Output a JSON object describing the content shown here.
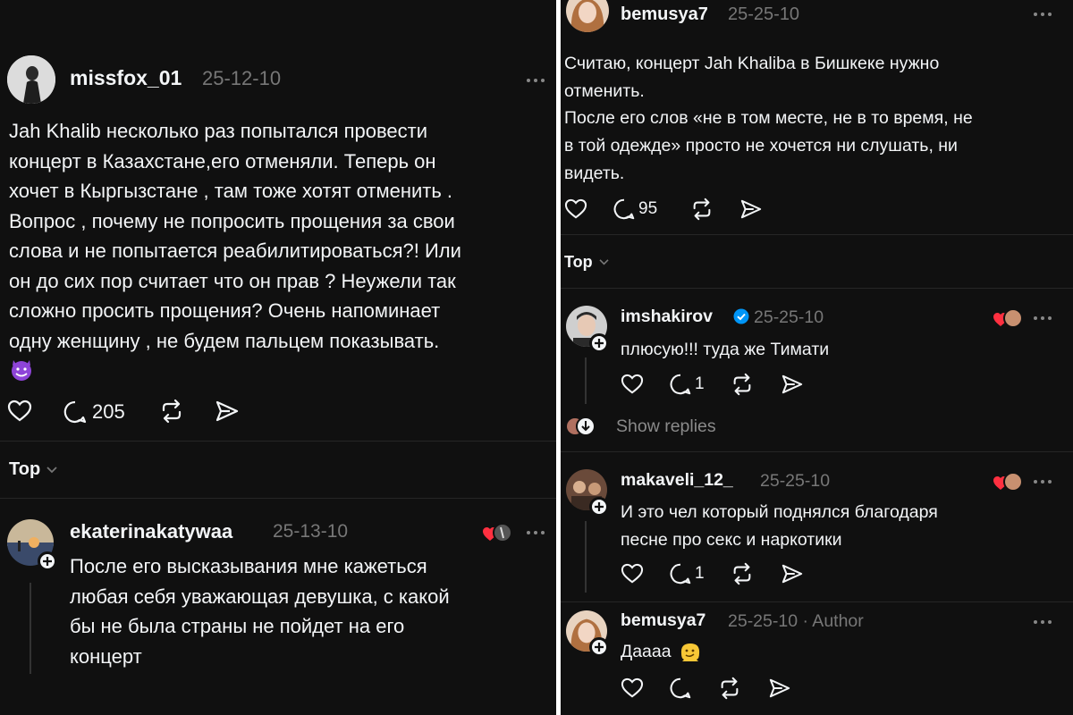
{
  "left": {
    "post": {
      "username": "missfox_01",
      "date": "25-12-10",
      "lines": [
        "Jah Khalib несколько раз попытался провести",
        "концерт в Казахстане,его отменяли. Теперь он",
        "хочет в Кыргызстане , там тоже хотят отменить .",
        "Вопрос , почему не попросить прощения за свои",
        "слова и не попытается реабилитироваться?! Или",
        "он до сих пор считает что он прав ? Неужели так",
        "сложно просить прощения? Очень напоминает",
        "одну женщину , не будем пальцем показывать."
      ],
      "emoji_icon": "smiling-devil-emoji",
      "reply_count": "205"
    },
    "sort_label": "Top",
    "reply": {
      "username": "ekaterinakatywaa",
      "date": "25-13-10",
      "lines": [
        "После его высказывания мне кажеться",
        "любая себя уважающая девушка, с какой",
        "бы не была страны не пойдет на его",
        "концерт"
      ]
    }
  },
  "right": {
    "post": {
      "username": "bemusya7",
      "date": "25-25-10",
      "lines": [
        "Считаю, концерт Jah Khaliba в Бишкеке нужно",
        "отменить."
      ],
      "lines2": [
        "После его слов «не в том месте, не в то время, не",
        "в той одежде» просто не хочется ни слушать, ни",
        "видеть."
      ],
      "reply_count": "95"
    },
    "sort_label": "Top",
    "replies": [
      {
        "username": "imshakirov",
        "verified": true,
        "date": "25-25-10",
        "text": "плюсую!!! туда же Тимати",
        "reply_count": "1"
      },
      {
        "username": "makaveli_12_",
        "date": "25-25-10",
        "lines": [
          "И это чел который поднялся благодаря",
          "песне про секс и наркотики"
        ],
        "reply_count": "1"
      },
      {
        "username": "bemusya7",
        "date": "25-25-10 · Author",
        "text": "Даааа",
        "emoji_icon": "melting-face-emoji"
      }
    ],
    "show_replies_label": "Show replies"
  },
  "colors": {
    "background": "#101010",
    "text": "#f3f5f7",
    "muted": "#777777",
    "heart": "#ff3040",
    "verified": "#0095f6"
  }
}
